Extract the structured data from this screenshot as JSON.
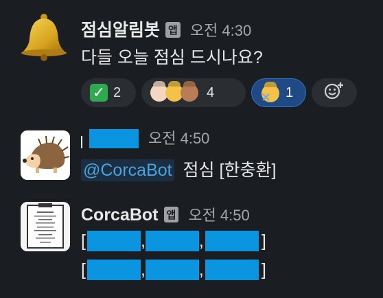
{
  "messages": [
    {
      "sender": "점심알림봇",
      "badge": "앱",
      "time": "오전 4:30",
      "text": "다들 오늘 점심 드시나요?",
      "avatar_icon": "bell-icon",
      "reactions": [
        {
          "emoji": "check-mark-icon",
          "count": "2"
        },
        {
          "emoji": "person-gesturing-ok-icon",
          "count": "4"
        },
        {
          "emoji": "person-gesturing-no-icon",
          "count": "1",
          "selected": true
        }
      ],
      "add_reaction_icon": "add-reaction-icon"
    },
    {
      "sender": "",
      "time": "오전 4:50",
      "mention": "@CorcaBot",
      "text": "점심 [한충환]",
      "avatar_icon": "hedgehog-icon"
    },
    {
      "sender": "CorcaBot",
      "badge": "앱",
      "time": "오전 4:50",
      "lines": [
        {
          "open": "[",
          "sep1": ",",
          "sep2": ",",
          "close": "]"
        },
        {
          "open": "[",
          "sep1": ",",
          "sep2": ",",
          "close": "]"
        }
      ],
      "avatar_icon": "menu-document-icon"
    }
  ],
  "colors": {
    "background": "#1a1d21",
    "redaction": "#0b95e0",
    "mention_text": "#4aa3df",
    "selected_reaction": "#1f4a85"
  }
}
